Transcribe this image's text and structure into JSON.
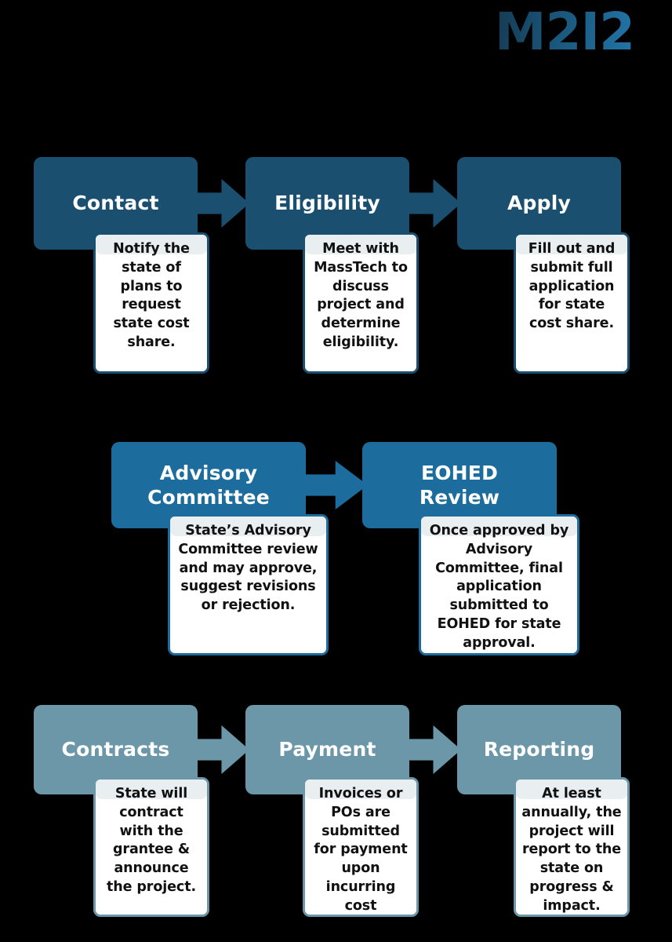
{
  "brand": {
    "logo_text": "M2I2",
    "logo_gradient_start": "#143a52",
    "logo_gradient_end": "#2176a8"
  },
  "colors": {
    "background": "#000000",
    "row1_accent": "#1a4f70",
    "row2_accent": "#1c6d9e",
    "row3_accent": "#6b97a8",
    "card_background": "#ffffff",
    "card_strip": "#e9eef1",
    "card_text": "#111111",
    "stage_label_text": "#ffffff"
  },
  "diagram": {
    "type": "process-flow",
    "rows": [
      {
        "id": "row-1",
        "accent": "#1a4f70",
        "stages": [
          {
            "key": "contact",
            "title": "Contact",
            "description": "Notify the state of plans to request state cost share.",
            "arrow_after": true
          },
          {
            "key": "eligibility",
            "title": "Eligibility",
            "description": "Meet with MassTech to discuss project and determine eligibility.",
            "arrow_after": true
          },
          {
            "key": "apply",
            "title": "Apply",
            "description": "Fill out and submit full application for state cost share.",
            "arrow_after": false
          }
        ]
      },
      {
        "id": "row-2",
        "accent": "#1c6d9e",
        "stages": [
          {
            "key": "advisory-committee",
            "title": "Advisory\nCommittee",
            "description": "State’s Advisory Committee review and may approve, suggest revisions or rejection.",
            "arrow_after": true
          },
          {
            "key": "eohed-review",
            "title": "EOHED\nReview",
            "description": "Once approved by Advisory Committee, final application submitted to EOHED for state approval.",
            "arrow_after": false
          }
        ]
      },
      {
        "id": "row-3",
        "accent": "#6b97a8",
        "stages": [
          {
            "key": "contracts",
            "title": "Contracts",
            "description": "State will contract with the grantee & announce the project.",
            "arrow_after": true
          },
          {
            "key": "payment",
            "title": "Payment",
            "description": "Invoices or POs are submitted for payment upon incurring cost",
            "arrow_after": true
          },
          {
            "key": "reporting",
            "title": "Reporting",
            "description": "At least annually, the project will report to the state on progress & impact.",
            "arrow_after": false
          }
        ]
      }
    ]
  }
}
